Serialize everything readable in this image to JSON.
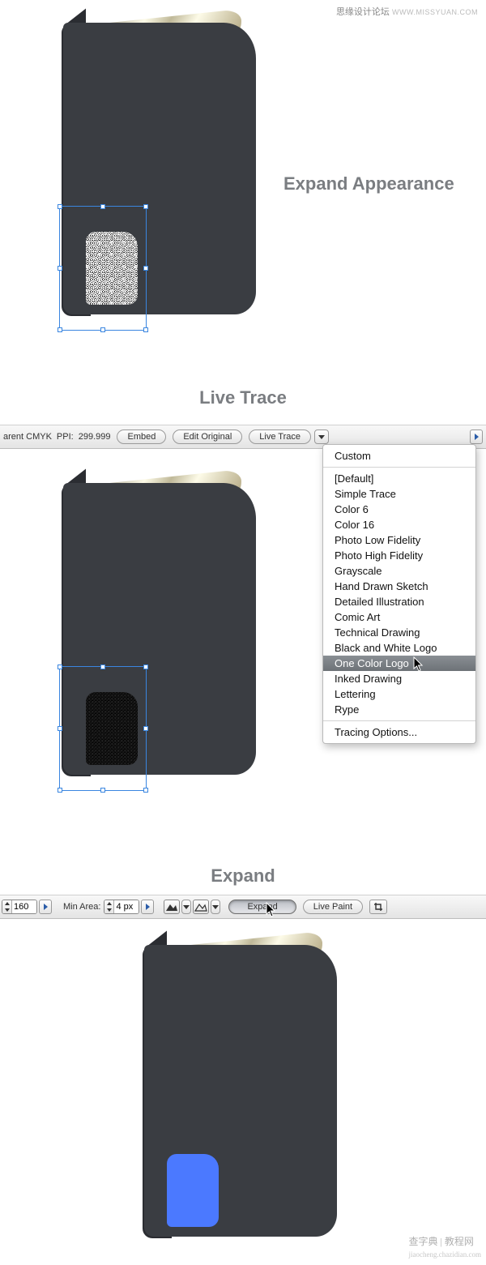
{
  "watermarks": {
    "top_text": "思缘设计论坛",
    "top_url": "WWW.MISSYUAN.COM",
    "bottom_text": "查字典 | 教程网",
    "bottom_url": "jiaocheng.chazidian.com"
  },
  "step1": {
    "title": "Expand Appearance"
  },
  "step2": {
    "title": "Live Trace",
    "bar": {
      "mode_label": "arent CMYK",
      "ppi_label": "PPI:",
      "ppi_value": "299.999",
      "embed_btn": "Embed",
      "edit_original_btn": "Edit Original",
      "live_trace_btn": "Live Trace"
    },
    "menu": {
      "custom": "Custom",
      "items": [
        "[Default]",
        "Simple Trace",
        "Color 6",
        "Color 16",
        "Photo Low Fidelity",
        "Photo High Fidelity",
        "Grayscale",
        "Hand Drawn Sketch",
        "Detailed Illustration",
        "Comic Art",
        "Technical Drawing",
        "Black and White Logo",
        "One Color Logo",
        "Inked Drawing",
        "Lettering",
        "Rype"
      ],
      "selected_index": 12,
      "options": "Tracing Options..."
    }
  },
  "step3": {
    "title": "Expand",
    "bar": {
      "threshold_value": "160",
      "min_area_label": "Min Area:",
      "min_area_value": "4 px",
      "expand_btn": "Expand",
      "live_paint_btn": "Live Paint"
    }
  }
}
